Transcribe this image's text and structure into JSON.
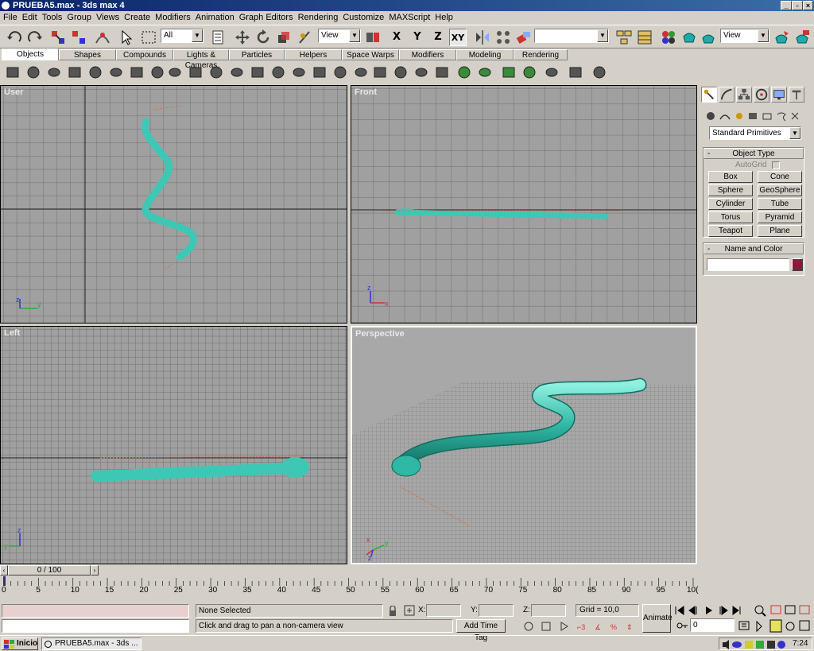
{
  "window": {
    "title": "PRUEBA5.max - 3ds max 4"
  },
  "menu": [
    "File",
    "Edit",
    "Tools",
    "Group",
    "Views",
    "Create",
    "Modifiers",
    "Animation",
    "Graph Editors",
    "Rendering",
    "Customize",
    "MAXScript",
    "Help"
  ],
  "toolbar": {
    "selection_filter": "All",
    "ref_coord": "View",
    "named_selection": "",
    "render_view": "View",
    "axis_x": "X",
    "axis_y": "Y",
    "axis_z": "Z",
    "axis_xy": "XY"
  },
  "tabs": [
    "Objects",
    "Shapes",
    "Compounds",
    "Lights & Cameras",
    "Particles",
    "Helpers",
    "Space Warps",
    "Modifiers",
    "Modeling",
    "Rendering"
  ],
  "viewports": {
    "top_left": "User",
    "top_right": "Front",
    "bottom_left": "Left",
    "bottom_right": "Perspective"
  },
  "axis_labels": {
    "x": "x",
    "y": "y",
    "z": "z"
  },
  "command_panel": {
    "category": "Standard Primitives",
    "object_type_title": "Object Type",
    "autogrid": "AutoGrid",
    "buttons": [
      "Box",
      "Cone",
      "Sphere",
      "GeoSphere",
      "Cylinder",
      "Tube",
      "Torus",
      "Pyramid",
      "Teapot",
      "Plane"
    ],
    "name_color_title": "Name and Color",
    "name_value": "",
    "color": "#8b1a3a",
    "rollout_minus": "-"
  },
  "time": {
    "slider_label": "0 / 100",
    "ticks": [
      "0",
      "5",
      "10",
      "15",
      "20",
      "25",
      "30",
      "35",
      "40",
      "45",
      "50",
      "55",
      "60",
      "65",
      "70",
      "75",
      "80",
      "85",
      "90",
      "95",
      "10("
    ]
  },
  "status": {
    "selection": "None Selected",
    "prompt": "Click and drag to pan a non-camera view",
    "x_label": "X:",
    "y_label": "Y:",
    "z_label": "Z:",
    "grid": "Grid = 10,0",
    "add_time_tag": "Add Time Tag",
    "animate": "Animate",
    "frame": "0"
  },
  "taskbar": {
    "start": "Inicio",
    "task": "PRUEBA5.max - 3ds ...",
    "clock": "7:24"
  },
  "colors": {
    "snake": "#3cc8b4",
    "title_gradient_start": "#0a246a",
    "viewport_grid": "#a0a0a0"
  }
}
